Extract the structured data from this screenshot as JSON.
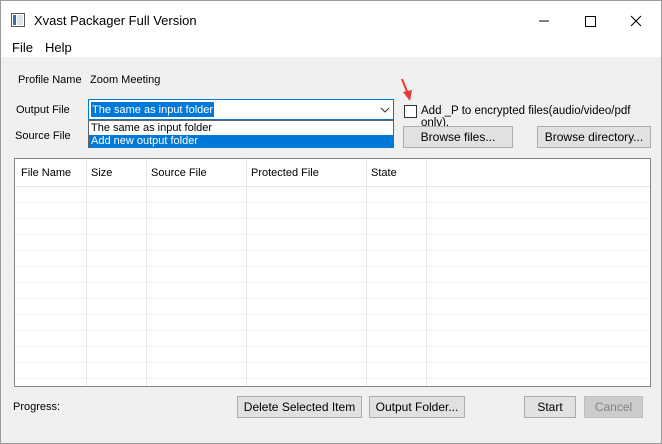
{
  "window": {
    "title": "Xvast Packager Full Version",
    "icon": "app-window-icon",
    "controls": [
      "minimize-icon",
      "maximize-icon",
      "close-icon"
    ]
  },
  "menu": {
    "file": "File",
    "help": "Help"
  },
  "profile": {
    "label": "Profile Name",
    "value": "Zoom Meeting"
  },
  "output": {
    "label": "Output File",
    "selected": "The same as input folder",
    "options": [
      "The same as input folder",
      "Add new output folder"
    ],
    "highlighted_option": "Add new output folder"
  },
  "source": {
    "label": "Source File"
  },
  "checkbox": {
    "label": "Add _P to encrypted files(audio/video/pdf only).",
    "checked": false
  },
  "buttons": {
    "browse_files": "Browse files...",
    "browse_directory": "Browse directory...",
    "delete_selected": "Delete Selected Item",
    "output_folder": "Output Folder...",
    "start": "Start",
    "cancel": "Cancel"
  },
  "table": {
    "columns": [
      "File Name",
      "Size",
      "Source File",
      "Protected File",
      "State"
    ],
    "rows": []
  },
  "progress": {
    "label": "Progress:"
  },
  "colors": {
    "accent": "#0078d7",
    "annotation_arrow": "#e53935",
    "window_bg": "#f0f0f0"
  }
}
